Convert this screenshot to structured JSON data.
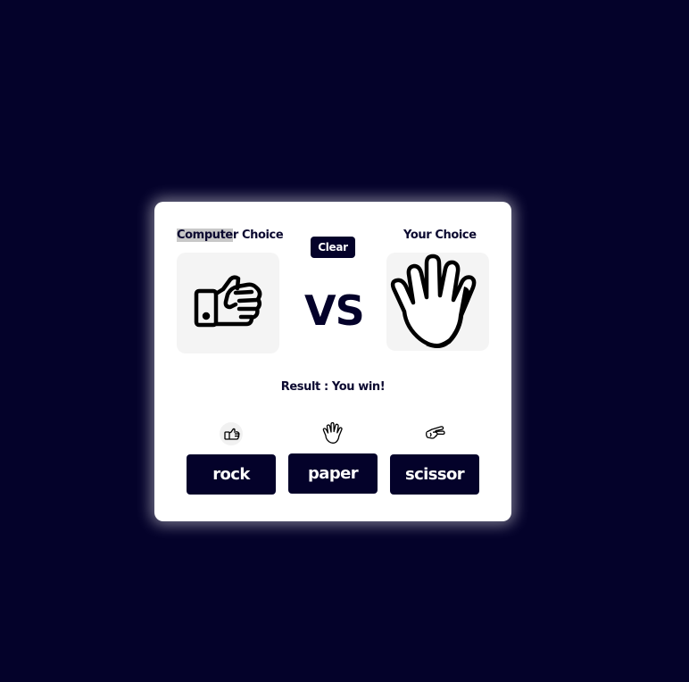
{
  "game": {
    "computer_label_highlighted": "Compute",
    "computer_label_rest": "r Choice",
    "your_label": "Your Choice",
    "clear_label": "Clear",
    "vs_text": "VS",
    "result_text": "Result : You win!",
    "computer_choice_icon": "fist-icon",
    "your_choice_icon": "open-hand-icon"
  },
  "options": [
    {
      "label": "rock",
      "icon": "rock-fist-icon"
    },
    {
      "label": "paper",
      "icon": "paper-hand-icon"
    },
    {
      "label": "scissor",
      "icon": "scissor-hand-icon"
    }
  ],
  "colors": {
    "background": "#04022a",
    "card": "#ffffff",
    "button": "#04022a",
    "button_text": "#ffffff",
    "choice_box": "#f4f4f4"
  }
}
